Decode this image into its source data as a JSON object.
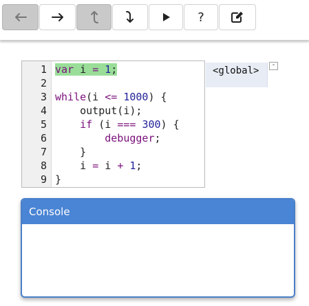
{
  "toolbar": {
    "buttons": [
      {
        "icon": "arrow-left-icon",
        "name": "step-back-button",
        "pressed": true
      },
      {
        "icon": "arrow-right-icon",
        "name": "step-forward-button",
        "pressed": false
      },
      {
        "icon": "step-out-icon",
        "name": "step-out-button",
        "pressed": true
      },
      {
        "icon": "step-into-icon",
        "name": "step-into-button",
        "pressed": false
      },
      {
        "icon": "play-icon",
        "name": "run-button",
        "pressed": false
      },
      {
        "icon": "help-icon",
        "name": "help-button",
        "pressed": false
      },
      {
        "icon": "edit-icon",
        "name": "edit-button",
        "pressed": false
      }
    ],
    "help_label": "?"
  },
  "editor": {
    "lines": [
      {
        "n": "1",
        "highlighted": true,
        "tokens": [
          [
            "kw",
            "var"
          ],
          [
            "t",
            " i "
          ],
          [
            "op",
            "="
          ],
          [
            "t",
            " "
          ],
          [
            "num",
            "1"
          ],
          [
            "t",
            ";"
          ]
        ]
      },
      {
        "n": "2",
        "highlighted": false,
        "tokens": []
      },
      {
        "n": "3",
        "highlighted": false,
        "tokens": [
          [
            "kw",
            "while"
          ],
          [
            "t",
            "(i "
          ],
          [
            "op",
            "<="
          ],
          [
            "t",
            " "
          ],
          [
            "num",
            "1000"
          ],
          [
            "t",
            ") {"
          ]
        ]
      },
      {
        "n": "4",
        "highlighted": false,
        "tokens": [
          [
            "t",
            "    output(i);"
          ]
        ]
      },
      {
        "n": "5",
        "highlighted": false,
        "tokens": [
          [
            "t",
            "    "
          ],
          [
            "kw",
            "if"
          ],
          [
            "t",
            " (i "
          ],
          [
            "op",
            "==="
          ],
          [
            "t",
            " "
          ],
          [
            "num",
            "300"
          ],
          [
            "t",
            ") {"
          ]
        ]
      },
      {
        "n": "6",
        "highlighted": false,
        "tokens": [
          [
            "t",
            "        "
          ],
          [
            "kw",
            "debugger"
          ],
          [
            "t",
            ";"
          ]
        ]
      },
      {
        "n": "7",
        "highlighted": false,
        "tokens": [
          [
            "t",
            "    }"
          ]
        ]
      },
      {
        "n": "8",
        "highlighted": false,
        "tokens": [
          [
            "t",
            "    i "
          ],
          [
            "op",
            "="
          ],
          [
            "t",
            " i "
          ],
          [
            "op",
            "+"
          ],
          [
            "t",
            " "
          ],
          [
            "num",
            "1"
          ],
          [
            "t",
            ";"
          ]
        ]
      },
      {
        "n": "9",
        "highlighted": false,
        "tokens": [
          [
            "t",
            "}"
          ]
        ]
      }
    ]
  },
  "scope": {
    "label": "<global>",
    "collapse_label": "-"
  },
  "console": {
    "title": "Console",
    "output": ""
  },
  "colors": {
    "highlight": "#99dd99",
    "console_header": "#4a84d4",
    "keyword": "#7a0f7a",
    "number": "#22229a"
  }
}
